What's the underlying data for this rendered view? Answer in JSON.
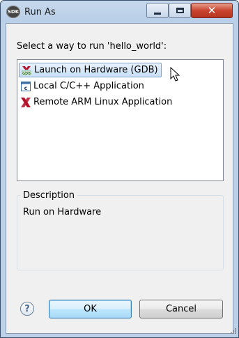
{
  "window": {
    "title": "Run As",
    "app_icon_text": "SDK"
  },
  "prompt": "Select a way to run 'hello_world':",
  "launch_items": [
    {
      "label": "Launch on Hardware (GDB)",
      "icon": "gdb-icon",
      "selected": true
    },
    {
      "label": "Local C/C++ Application",
      "icon": "c-application-icon",
      "selected": false
    },
    {
      "label": "Remote ARM Linux Application",
      "icon": "xilinx-icon",
      "selected": false
    }
  ],
  "description": {
    "label": "Description",
    "text": "Run on Hardware"
  },
  "buttons": {
    "help": "?",
    "ok": "OK",
    "cancel": "Cancel"
  },
  "colors": {
    "xilinx_red": "#b3102a",
    "selection": "#cde3f8",
    "title_bar": "#bcd1e8",
    "close_button": "#c9452f"
  }
}
